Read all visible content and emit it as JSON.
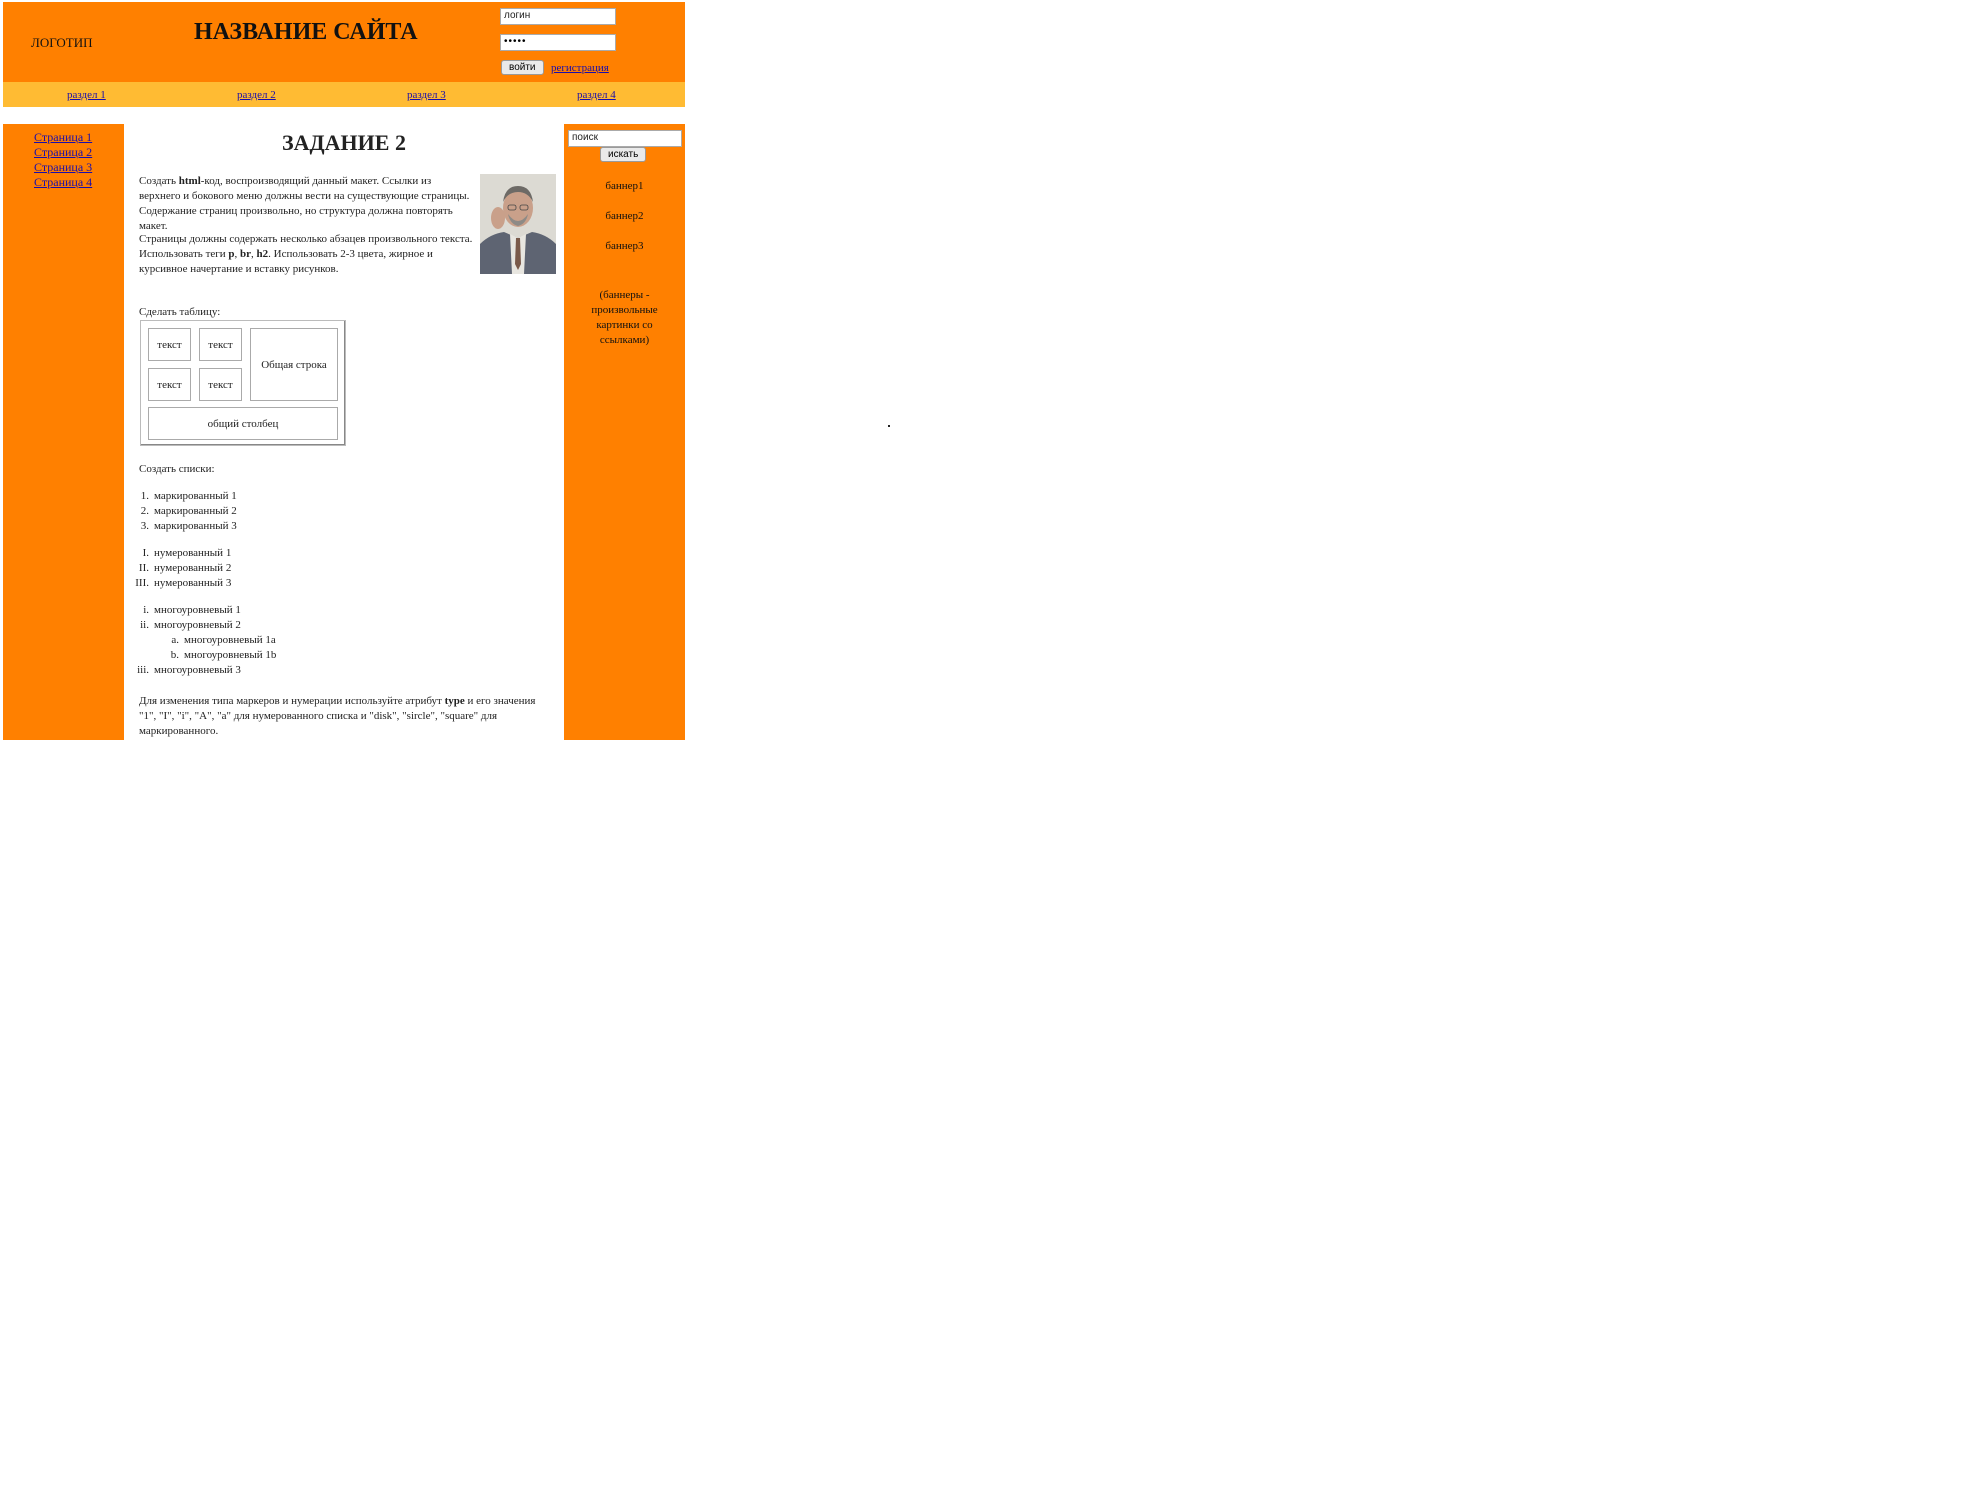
{
  "header": {
    "logo": "ЛОГОТИП",
    "site_title": "НАЗВАНИЕ САЙТА",
    "login_placeholder": "логин",
    "password_value": "•••••",
    "login_button": "войти",
    "register_link": "регистрация"
  },
  "topnav": {
    "items": [
      {
        "label": "раздел 1"
      },
      {
        "label": "раздел 2"
      },
      {
        "label": "раздел 3"
      },
      {
        "label": "раздел 4"
      }
    ]
  },
  "sidebar": {
    "items": [
      {
        "label": "Страница 1"
      },
      {
        "label": "Страница 2"
      },
      {
        "label": "Страница 3"
      },
      {
        "label": "Страница 4"
      }
    ]
  },
  "rightbar": {
    "search_value": "поиск",
    "search_button": "искать",
    "banners": [
      "баннер1",
      "баннер2",
      "баннер3"
    ],
    "banners_note": "(баннеры - произвольные картинки со ссылками)"
  },
  "main": {
    "title": "ЗАДАНИЕ 2",
    "p1": {
      "a": "Создать ",
      "b": "html",
      "c": "-код, воспроизводящий данный макет. Ссылки из верхнего и бокового меню должны вести на существующие страницы. Содержание страниц произвольно, но структура должна повторять макет."
    },
    "p2": {
      "a": "Страницы должны содержать несколько абзацев произвольного текста. Использовать теги ",
      "t1": "p",
      "sep1": ", ",
      "t2": "br",
      "sep2": ", ",
      "t3": "h2",
      "b": ". Использовать 2-3 цвета, жирное и курсивное начертание и вставку рисунков."
    },
    "table_label": "Сделать таблицу:",
    "table": {
      "cell_text": "текст",
      "merged_row": "Общая строка",
      "merged_col": "общий столбец"
    },
    "lists_label": "Создать списки:",
    "list_ordered": [
      {
        "marker": "1.",
        "text": "маркированный 1"
      },
      {
        "marker": "2.",
        "text": "маркированный 2"
      },
      {
        "marker": "3.",
        "text": "маркированный 3"
      }
    ],
    "list_roman": [
      {
        "marker": "I.",
        "text": "нумерованный 1"
      },
      {
        "marker": "II.",
        "text": "нумерованный 2"
      },
      {
        "marker": "III.",
        "text": "нумерованный 3"
      }
    ],
    "list_multi": [
      {
        "marker": "i.",
        "text": "многоуровневый 1"
      },
      {
        "marker": "ii.",
        "text": "многоуровневый 2"
      },
      {
        "marker": "a.",
        "text": "многоуровневый 1a"
      },
      {
        "marker": "b.",
        "text": "многоуровневый 1b"
      },
      {
        "marker": "iii.",
        "text": "многоуровневый 3"
      }
    ],
    "footer": {
      "a": "Для изменения типа маркеров и нумерации используйте атрибут ",
      "b": "type",
      "c": " и его значения \"1\", \"I\", \"i\", \"A\", \"a\" для нумерованного списка и \"disk\", \"sircle\", \"square\" для маркированного."
    }
  }
}
